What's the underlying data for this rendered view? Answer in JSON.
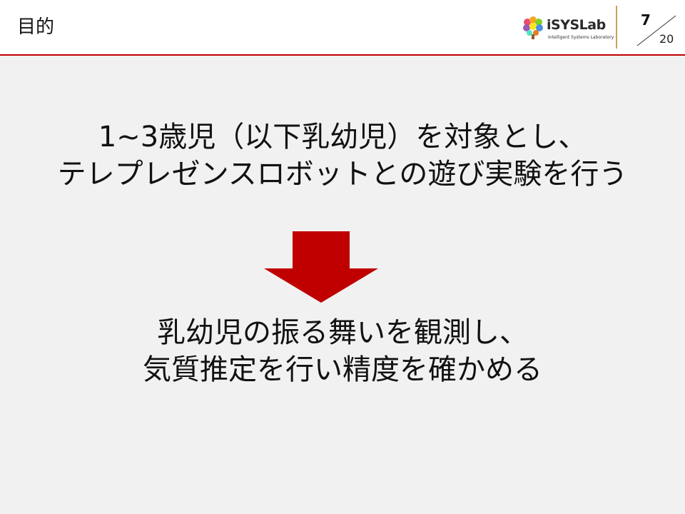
{
  "header": {
    "title": "目的",
    "logo": {
      "name": "iSYSLab",
      "subtitle": "Intelligent Systems Laboratory"
    },
    "page": {
      "current": "7",
      "total": "20"
    }
  },
  "content": {
    "statement_lines": [
      "1~3歳児（以下乳幼児）を対象とし、",
      "テレプレゼンスロボットとの遊び実験を行う"
    ],
    "result_lines": [
      "乳幼児の振る舞いを観測し、",
      "気質推定を行い精度を確かめる"
    ]
  },
  "colors": {
    "accent": "#c00000",
    "background": "#f2f1f1",
    "header_background": "#ffffff"
  }
}
